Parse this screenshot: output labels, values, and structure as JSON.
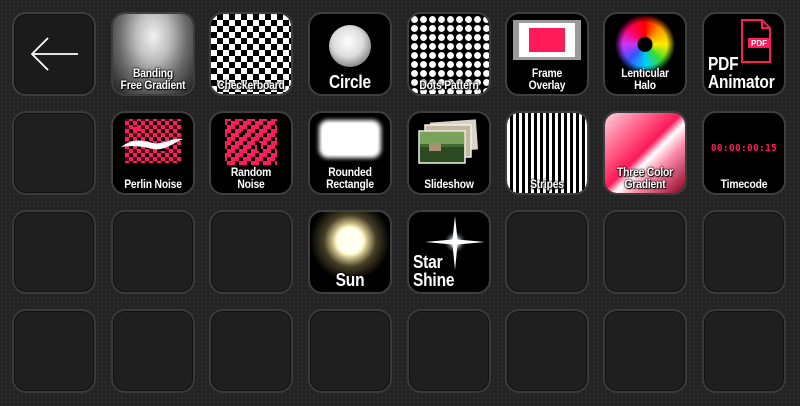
{
  "accent_color": "#ff1a5a",
  "keys": [
    {
      "name": "back-button",
      "label": "",
      "icon": "arrow-left-icon"
    },
    {
      "name": "key-banding-free-gradient",
      "label": "Banding\nFree Gradient",
      "icon": "gradient-icon"
    },
    {
      "name": "key-checkerboard",
      "label": "Checkerboard",
      "icon": "checkerboard-icon"
    },
    {
      "name": "key-circle",
      "label": "Circle",
      "icon": "circle-icon"
    },
    {
      "name": "key-dots-pattern",
      "label": "Dots Pattern",
      "icon": "dots-pattern-icon"
    },
    {
      "name": "key-frame-overlay",
      "label": "Frame\nOverlay",
      "icon": "frame-overlay-icon"
    },
    {
      "name": "key-lenticular-halo",
      "label": "Lenticular\nHalo",
      "icon": "halo-icon"
    },
    {
      "name": "key-pdf-animator",
      "label": "PDF\nAnimator",
      "icon": "pdf-file-icon",
      "icon_text": "PDF"
    },
    {
      "name": "key-empty",
      "label": "",
      "icon": ""
    },
    {
      "name": "key-perlin-noise",
      "label": "Perlin Noise",
      "icon": "perlin-noise-icon"
    },
    {
      "name": "key-random-noise",
      "label": "Random Noise",
      "icon": "random-noise-icon"
    },
    {
      "name": "key-rounded-rectangle",
      "label": "Rounded\nRectangle",
      "icon": "rounded-rectangle-icon"
    },
    {
      "name": "key-slideshow",
      "label": "Slideshow",
      "icon": "slideshow-icon"
    },
    {
      "name": "key-stripes",
      "label": "Stripes",
      "icon": "stripes-icon"
    },
    {
      "name": "key-three-color-gradient",
      "label": "Three Color\nGradient",
      "icon": "three-color-gradient-icon"
    },
    {
      "name": "key-timecode",
      "label": "Timecode",
      "icon": "timecode-icon",
      "icon_text": "00:00:00:15"
    },
    {
      "name": "key-empty",
      "label": "",
      "icon": ""
    },
    {
      "name": "key-empty",
      "label": "",
      "icon": ""
    },
    {
      "name": "key-empty",
      "label": "",
      "icon": ""
    },
    {
      "name": "key-sun",
      "label": "Sun",
      "icon": "sun-icon"
    },
    {
      "name": "key-star-shine",
      "label": "Star\nShine",
      "icon": "star-shine-icon"
    },
    {
      "name": "key-empty",
      "label": "",
      "icon": ""
    },
    {
      "name": "key-empty",
      "label": "",
      "icon": ""
    },
    {
      "name": "key-empty",
      "label": "",
      "icon": ""
    },
    {
      "name": "key-empty",
      "label": "",
      "icon": ""
    },
    {
      "name": "key-empty",
      "label": "",
      "icon": ""
    },
    {
      "name": "key-empty",
      "label": "",
      "icon": ""
    },
    {
      "name": "key-empty",
      "label": "",
      "icon": ""
    },
    {
      "name": "key-empty",
      "label": "",
      "icon": ""
    },
    {
      "name": "key-empty",
      "label": "",
      "icon": ""
    },
    {
      "name": "key-empty",
      "label": "",
      "icon": ""
    },
    {
      "name": "key-empty",
      "label": "",
      "icon": ""
    }
  ]
}
